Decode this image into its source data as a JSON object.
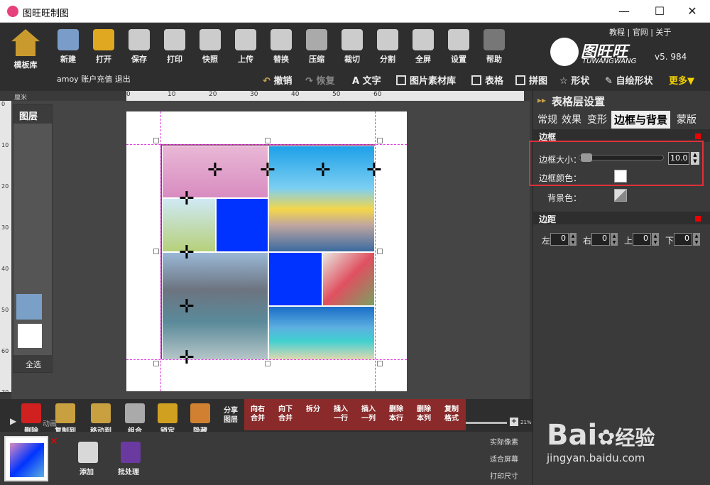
{
  "window": {
    "title": "图旺旺制图",
    "minimize": "—",
    "maximize": "☐",
    "close": "✕"
  },
  "toolbar": {
    "template_label": "模板库",
    "buttons": [
      "新建",
      "打开",
      "保存",
      "打印",
      "快照",
      "上传",
      "替换",
      "压缩",
      "裁切",
      "分割",
      "全屏",
      "设置",
      "帮助"
    ],
    "account": "amoy 账户充值 退出",
    "links": [
      "教程",
      "官网",
      "关于"
    ],
    "brand": "图旺旺",
    "brand_en": "TUWANGWANG",
    "version": "v5. 984",
    "undo": "撤销",
    "redo": "恢复",
    "sub_tools": [
      "文字",
      "图片素材库",
      "表格",
      "拼图",
      "形状",
      "自绘形状"
    ],
    "more": "更多▼"
  },
  "ruler": {
    "unit": "厘米",
    "ticks": [
      "0",
      "10",
      "20",
      "30",
      "40",
      "50",
      "60"
    ],
    "left_ticks": [
      "0",
      "10",
      "20",
      "30",
      "40",
      "50",
      "60",
      "70"
    ]
  },
  "layers": {
    "title": "图层",
    "select_all": "全选"
  },
  "panel": {
    "title": "表格层设置",
    "tabs": [
      "常规",
      "效果",
      "变形",
      "边框与背景",
      "蒙版"
    ],
    "border_section": "边框",
    "border_size_label": "边框大小：",
    "border_size_value": "10.0",
    "border_color_label": "边框颜色：",
    "bg_color_label": "背景色：",
    "margin_section": "边距",
    "margins": [
      {
        "label": "左",
        "value": "0"
      },
      {
        "label": "右",
        "value": "0"
      },
      {
        "label": "上",
        "value": "0"
      },
      {
        "label": "下",
        "value": "0"
      }
    ]
  },
  "bottom": {
    "tools": [
      "删除",
      "复制到",
      "移动到",
      "组合",
      "锁定",
      "隐藏"
    ],
    "share": "分享图层",
    "table_ops": [
      "向右合并",
      "向下合并",
      "拆分",
      "插入一行",
      "插入一列",
      "删除本行",
      "删除本列",
      "复制格式"
    ],
    "add": "添加",
    "batch": "批处理",
    "actual_pixels": "实际像素",
    "fit_screen": "适合屏幕",
    "print_size": "打印尺寸",
    "zoom": "21%",
    "anim": "动画"
  },
  "watermark": {
    "logo": "Bai",
    "logo_cn": "经验",
    "url": "jingyan.baidu.com"
  },
  "colors": {
    "accent": "#e0303a",
    "blue_cell": "#0033ff",
    "red_bar": "#8a2a2a"
  }
}
